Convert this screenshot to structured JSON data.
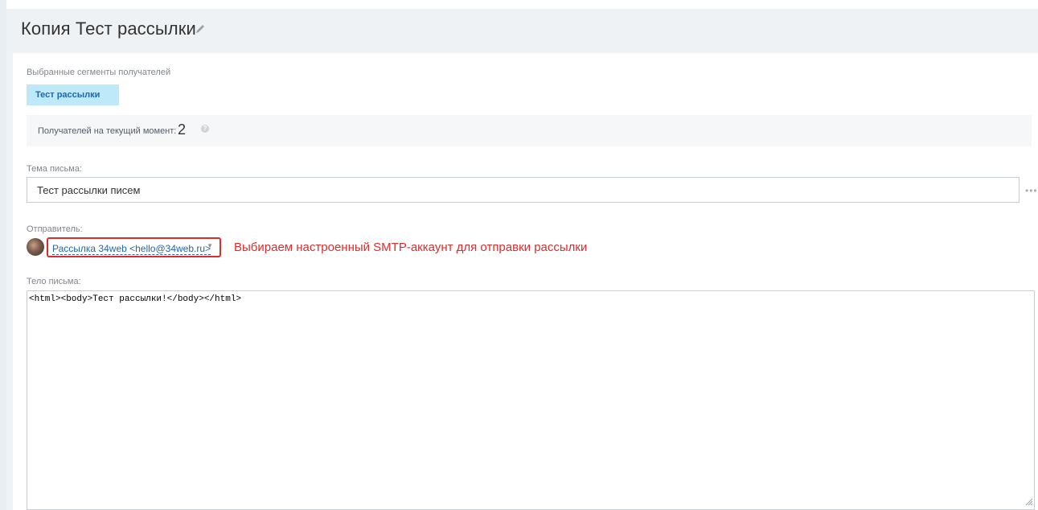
{
  "header": {
    "title": "Копия Тест рассылки"
  },
  "segments": {
    "label": "Выбранные сегменты получателей",
    "items": [
      {
        "label": "Тест рассылки"
      }
    ]
  },
  "recipients": {
    "label": "Получателей на текущий момент:",
    "count": "2",
    "help_icon": "question-circle-icon"
  },
  "subject": {
    "label": "Тема письма:",
    "value": "Тест рассылки писем",
    "more_icon": "ellipsis-icon"
  },
  "sender": {
    "label": "Отправитель:",
    "value": "Рассылка 34web <hello@34web.ru>",
    "caret_icon": "chevron-down-icon",
    "annotation": "Выбираем настроенный SMTP-аккаунт для отправки рассылки"
  },
  "body": {
    "label": "Тело письма:",
    "value": "<html><body>Тест рассылки!</body></html>"
  },
  "colors": {
    "accent": "#2067b0",
    "annotation": "#e02b2b",
    "chip_background": "#bde9f8",
    "header_background": "#eef2f4"
  }
}
